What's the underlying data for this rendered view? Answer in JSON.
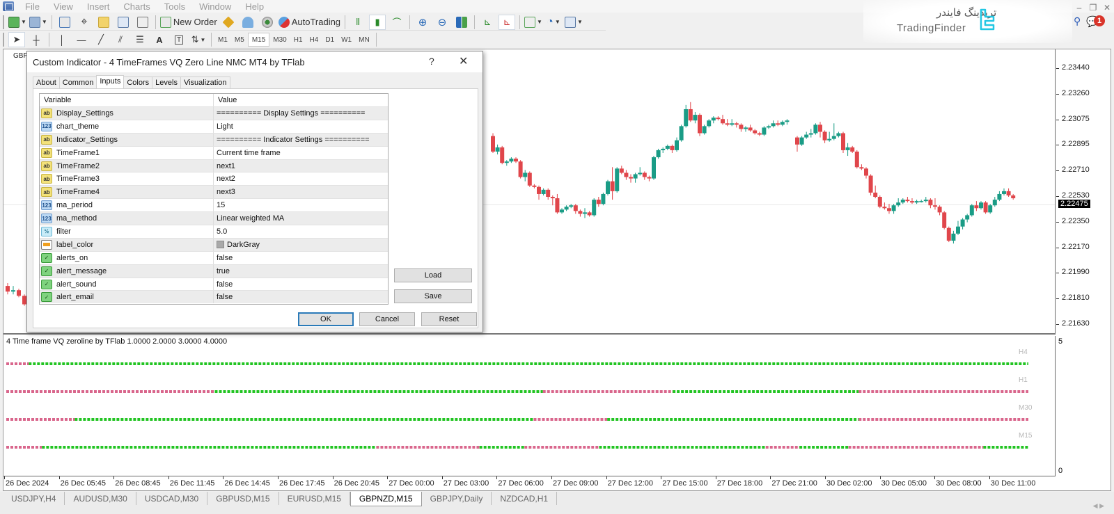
{
  "menu": [
    "File",
    "View",
    "Insert",
    "Charts",
    "Tools",
    "Window",
    "Help"
  ],
  "toolbar": {
    "new_order_label": "New Order",
    "autotrading_label": "AutoTrading",
    "timeframes": [
      "M1",
      "M5",
      "M15",
      "M30",
      "H1",
      "H4",
      "D1",
      "W1",
      "MN"
    ],
    "active_timeframe": "M15"
  },
  "branding": {
    "name_fa": "تریدینگ فایندر",
    "name_en": "TradingFinder",
    "accent": "#22c7e3"
  },
  "notifications": {
    "count": "1"
  },
  "chart": {
    "symbol_label": "GBP",
    "price_labels": [
      "2.23440",
      "2.23260",
      "2.23075",
      "2.22895",
      "2.22710",
      "2.22530",
      "2.22350",
      "2.22170",
      "2.21990",
      "2.21810",
      "2.21630"
    ],
    "current_price": "2.22475",
    "time_labels": [
      "26 Dec 2024",
      "26 Dec 05:45",
      "26 Dec 08:45",
      "26 Dec 11:45",
      "26 Dec 14:45",
      "26 Dec 17:45",
      "26 Dec 20:45",
      "27 Dec 00:00",
      "27 Dec 03:00",
      "27 Dec 06:00",
      "27 Dec 09:00",
      "27 Dec 12:00",
      "27 Dec 15:00",
      "27 Dec 18:00",
      "27 Dec 21:00",
      "30 Dec 02:00",
      "30 Dec 05:00",
      "30 Dec 08:00",
      "30 Dec 11:00"
    ],
    "bull_color": "#1a9c86",
    "bear_color": "#e0464b"
  },
  "indicator": {
    "title": "4 Time frame VQ zeroline by TFlab 1.0000 2.0000 3.0000 4.0000",
    "axis_max": "5",
    "axis_min": "0",
    "bull_color": "#22c422",
    "bear_color": "#d9668c"
  },
  "chart_data": {
    "type": "candlestick",
    "symbol": "GBPNZD",
    "timeframe": "M15",
    "ylim": [
      2.2155,
      2.2352
    ],
    "candles_visible_from_dialog_edge": [
      [
        2.2296,
        2.2298,
        2.2284,
        2.2285
      ],
      [
        2.2285,
        2.229,
        2.2283,
        2.2288
      ],
      [
        2.2288,
        2.2289,
        2.2276,
        2.2277
      ],
      [
        2.2277,
        2.2279,
        2.2275,
        2.2278
      ],
      [
        2.2278,
        2.2281,
        2.2277,
        2.228
      ],
      [
        2.228,
        2.2281,
        2.2277,
        2.2278
      ],
      [
        2.2278,
        2.2279,
        2.2266,
        2.2267
      ],
      [
        2.2267,
        2.2272,
        2.2264,
        2.227
      ],
      [
        2.227,
        2.2271,
        2.226,
        2.2261
      ],
      [
        2.2261,
        2.2262,
        2.2259,
        2.226
      ],
      [
        2.226,
        2.2261,
        2.2251,
        2.2255
      ],
      [
        2.2255,
        2.2259,
        2.2254,
        2.2258
      ],
      [
        2.2258,
        2.2259,
        2.2251,
        2.2253
      ],
      [
        2.2253,
        2.2254,
        2.2247,
        2.2252
      ],
      [
        2.2252,
        2.2255,
        2.2241,
        2.2242
      ],
      [
        2.2242,
        2.2245,
        2.2241,
        2.2244
      ],
      [
        2.2244,
        2.2247,
        2.2243,
        2.2246
      ],
      [
        2.2246,
        2.2248,
        2.2245,
        2.2247
      ],
      [
        2.2247,
        2.2248,
        2.2241,
        2.2243
      ],
      [
        2.2243,
        2.2244,
        2.2239,
        2.2241
      ],
      [
        2.2241,
        2.2245,
        2.2238,
        2.2242
      ],
      [
        2.2242,
        2.2243,
        2.2239,
        2.224
      ],
      [
        2.224,
        2.2252,
        2.2239,
        2.2251
      ],
      [
        2.2251,
        2.2253,
        2.2246,
        2.2248
      ],
      [
        2.2248,
        2.2256,
        2.2247,
        2.2255
      ],
      [
        2.2255,
        2.2265,
        2.2254,
        2.2264
      ],
      [
        2.2264,
        2.2274,
        2.2251,
        2.2257
      ],
      [
        2.2257,
        2.2274,
        2.2256,
        2.2273
      ],
      [
        2.2273,
        2.2275,
        2.2269,
        2.227
      ],
      [
        2.227,
        2.2272,
        2.2265,
        2.2267
      ],
      [
        2.2267,
        2.2269,
        2.2263,
        2.2266
      ],
      [
        2.2266,
        2.227,
        2.2263,
        2.2269
      ],
      [
        2.2269,
        2.2274,
        2.2268,
        2.227
      ],
      [
        2.227,
        2.2271,
        2.2265,
        2.2267
      ],
      [
        2.2267,
        2.2268,
        2.2264,
        2.2266
      ],
      [
        2.2266,
        2.2282,
        2.2265,
        2.2281
      ],
      [
        2.2281,
        2.2287,
        2.228,
        2.2286
      ],
      [
        2.2286,
        2.2288,
        2.2284,
        2.2287
      ],
      [
        2.2287,
        2.229,
        2.2286,
        2.2289
      ],
      [
        2.2289,
        2.229,
        2.2284,
        2.2286
      ],
      [
        2.2286,
        2.2295,
        2.2285,
        2.2293
      ],
      [
        2.2293,
        2.2304,
        2.2292,
        2.2303
      ],
      [
        2.2303,
        2.2318,
        2.2302,
        2.2315
      ],
      [
        2.2315,
        2.232,
        2.2306,
        2.2307
      ],
      [
        2.2307,
        2.2313,
        2.2305,
        2.2311
      ],
      [
        2.2311,
        2.2312,
        2.2296,
        2.2298
      ],
      [
        2.2298,
        2.2304,
        2.2297,
        2.2303
      ],
      [
        2.2303,
        2.2308,
        2.2302,
        2.2307
      ],
      [
        2.2307,
        2.231,
        2.2305,
        2.2309
      ],
      [
        2.2309,
        2.231,
        2.2307,
        2.2308
      ],
      [
        2.2308,
        2.2311,
        2.2304,
        2.2305
      ],
      [
        2.2305,
        2.2308,
        2.2303,
        2.2304
      ],
      [
        2.2304,
        2.2308,
        2.2303,
        2.2305
      ],
      [
        2.2305,
        2.2306,
        2.2302,
        2.2304
      ],
      [
        2.2304,
        2.2305,
        2.2299,
        2.2301
      ],
      [
        2.2301,
        2.2303,
        2.2299,
        2.2302
      ],
      [
        2.2302,
        2.2304,
        2.2299,
        2.23
      ],
      [
        2.23,
        2.2301,
        2.2297,
        2.2298
      ],
      [
        2.2298,
        2.2299,
        2.2296,
        2.2297
      ],
      [
        2.2297,
        2.2303,
        2.2296,
        2.2302
      ],
      [
        2.2302,
        2.2304,
        2.2301,
        2.2303
      ],
      [
        2.2303,
        2.2307,
        2.2302,
        2.2305
      ],
      [
        2.2305,
        2.2307,
        2.2303,
        2.2304
      ],
      [
        2.2304,
        2.2307,
        2.2303,
        2.2306
      ],
      [
        2.2306,
        2.2308,
        2.2304,
        2.2307
      ],
      [
        2.2295,
        2.2296,
        2.2285,
        2.229
      ],
      [
        2.229,
        2.2296,
        2.2289,
        2.2295
      ],
      [
        2.2295,
        2.2299,
        2.2294,
        2.2297
      ],
      [
        2.2297,
        2.2301,
        2.2295,
        2.2298
      ],
      [
        2.2298,
        2.2305,
        2.2297,
        2.2304
      ],
      [
        2.2304,
        2.2306,
        2.2295,
        2.2299
      ],
      [
        2.2299,
        2.23,
        2.2291,
        2.2293
      ],
      [
        2.2293,
        2.2299,
        2.2292,
        2.2294
      ],
      [
        2.2294,
        2.2305,
        2.2293,
        2.2296
      ],
      [
        2.2296,
        2.2299,
        2.2295,
        2.2298
      ],
      [
        2.2298,
        2.2299,
        2.2284,
        2.2286
      ],
      [
        2.2286,
        2.2291,
        2.2282,
        2.2288
      ],
      [
        2.2288,
        2.2289,
        2.2284,
        2.2285
      ],
      [
        2.2285,
        2.2286,
        2.2273,
        2.2274
      ],
      [
        2.2274,
        2.2276,
        2.2272,
        2.2273
      ],
      [
        2.2273,
        2.2274,
        2.2266,
        2.2268
      ],
      [
        2.2268,
        2.2269,
        2.2254,
        2.2256
      ],
      [
        2.2256,
        2.2261,
        2.2252,
        2.2253
      ],
      [
        2.2253,
        2.2254,
        2.2245,
        2.2246
      ],
      [
        2.2246,
        2.2249,
        2.2244,
        2.2245
      ],
      [
        2.2245,
        2.2248,
        2.2241,
        2.2243
      ],
      [
        2.2243,
        2.2248,
        2.2241,
        2.2247
      ],
      [
        2.2247,
        2.2252,
        2.2246,
        2.2249
      ],
      [
        2.2249,
        2.2252,
        2.2248,
        2.2251
      ],
      [
        2.2251,
        2.2253,
        2.2249,
        2.225
      ],
      [
        2.225,
        2.2252,
        2.2248,
        2.2249
      ],
      [
        2.2249,
        2.2251,
        2.2248,
        2.225
      ],
      [
        2.225,
        2.2251,
        2.2249,
        2.225
      ],
      [
        2.225,
        2.2253,
        2.2249,
        2.2251
      ],
      [
        2.2251,
        2.2252,
        2.2245,
        2.2247
      ],
      [
        2.2247,
        2.2252,
        2.2244,
        2.2246
      ],
      [
        2.2246,
        2.2247,
        2.224,
        2.2242
      ],
      [
        2.2242,
        2.2243,
        2.223,
        2.2231
      ],
      [
        2.2231,
        2.2232,
        2.2221,
        2.2222
      ],
      [
        2.2222,
        2.2229,
        2.222,
        2.2227
      ],
      [
        2.2227,
        2.2236,
        2.2226,
        2.2232
      ],
      [
        2.2232,
        2.2238,
        2.223,
        2.2237
      ],
      [
        2.2237,
        2.2241,
        2.2235,
        2.224
      ],
      [
        2.224,
        2.2248,
        2.2239,
        2.2247
      ],
      [
        2.2247,
        2.225,
        2.2243,
        2.2245
      ],
      [
        2.2245,
        2.225,
        2.2244,
        2.2249
      ],
      [
        2.2249,
        2.225,
        2.2241,
        2.2242
      ],
      [
        2.2242,
        2.2248,
        2.2241,
        2.2247
      ],
      [
        2.2247,
        2.2253,
        2.2246,
        2.2251
      ],
      [
        2.2251,
        2.2257,
        2.225,
        2.2255
      ],
      [
        2.2255,
        2.2259,
        2.2254,
        2.2257
      ],
      [
        2.2257,
        2.2259,
        2.2253,
        2.2254
      ],
      [
        2.2254,
        2.2255,
        2.2251,
        2.2252
      ]
    ],
    "indicator_rows": [
      {
        "label": "H4",
        "segments": [
          [
            "bear",
            0.0,
            0.022
          ],
          [
            "bull",
            0.022,
            1.0
          ]
        ]
      },
      {
        "label": "H1",
        "segments": [
          [
            "bear",
            0.0,
            0.204
          ],
          [
            "bull",
            0.204,
            0.525
          ],
          [
            "bear",
            0.525,
            0.652
          ],
          [
            "bull",
            0.652,
            0.834
          ],
          [
            "bear",
            0.834,
            1.0
          ]
        ]
      },
      {
        "label": "M30",
        "segments": [
          [
            "bear",
            0.0,
            0.067
          ],
          [
            "bull",
            0.067,
            0.516
          ],
          [
            "bear",
            0.516,
            0.588
          ],
          [
            "bull",
            0.588,
            0.834
          ],
          [
            "bear",
            0.834,
            1.0
          ]
        ]
      },
      {
        "label": "M15",
        "segments": [
          [
            "bear",
            0.0,
            0.035
          ],
          [
            "bull",
            0.035,
            0.362
          ],
          [
            "bear",
            0.362,
            0.463
          ],
          [
            "bull",
            0.463,
            0.507
          ],
          [
            "bear",
            0.507,
            0.58
          ],
          [
            "bull",
            0.58,
            0.743
          ],
          [
            "bear",
            0.743,
            0.776
          ],
          [
            "bull",
            0.776,
            0.824
          ],
          [
            "bear",
            0.824,
            0.956
          ],
          [
            "bull",
            0.956,
            1.0
          ]
        ]
      }
    ]
  },
  "dialog": {
    "title": "Custom Indicator - 4 TimeFrames VQ Zero Line NMC MT4 by TFlab",
    "help": "?",
    "close": "✕",
    "tabs": [
      "About",
      "Common",
      "Inputs",
      "Colors",
      "Levels",
      "Visualization"
    ],
    "active_tab": "Inputs",
    "columns": [
      "Variable",
      "Value"
    ],
    "inputs": [
      {
        "type": "string",
        "icon": "ab",
        "name": "Display_Settings",
        "value": "========== Display Settings =========="
      },
      {
        "type": "int",
        "icon": "123",
        "name": "chart_theme",
        "value": "Light"
      },
      {
        "type": "string",
        "icon": "ab",
        "name": "Indicator_Settings",
        "value": "========== Indicator Settings =========="
      },
      {
        "type": "string",
        "icon": "ab",
        "name": "TimeFrame1",
        "value": "Current time frame"
      },
      {
        "type": "string",
        "icon": "ab",
        "name": "TimeFrame2",
        "value": "next1"
      },
      {
        "type": "string",
        "icon": "ab",
        "name": "TimeFrame3",
        "value": "next2"
      },
      {
        "type": "string",
        "icon": "ab",
        "name": "TimeFrame4",
        "value": "next3"
      },
      {
        "type": "int",
        "icon": "123",
        "name": "ma_period",
        "value": "15"
      },
      {
        "type": "int",
        "icon": "123",
        "name": "ma_method",
        "value": "Linear weighted MA"
      },
      {
        "type": "double",
        "icon": "½",
        "name": "filter",
        "value": "5.0"
      },
      {
        "type": "color",
        "icon": "",
        "name": "label_color",
        "value": "DarkGray",
        "swatch": "#a9a9a9"
      },
      {
        "type": "bool",
        "icon": "✓",
        "name": "alerts_on",
        "value": "false"
      },
      {
        "type": "bool",
        "icon": "✓",
        "name": "alert_message",
        "value": "true"
      },
      {
        "type": "bool",
        "icon": "✓",
        "name": "alert_sound",
        "value": "false"
      },
      {
        "type": "bool",
        "icon": "✓",
        "name": "alert_email",
        "value": "false"
      }
    ],
    "buttons": {
      "load": "Load",
      "save": "Save",
      "ok": "OK",
      "cancel": "Cancel",
      "reset": "Reset"
    }
  },
  "bottom_tabs": [
    "USDJPY,H4",
    "AUDUSD,M30",
    "USDCAD,M30",
    "GBPUSD,M15",
    "EURUSD,M15",
    "GBPNZD,M15",
    "GBPJPY,Daily",
    "NZDCAD,H1"
  ],
  "active_bottom_tab": "GBPNZD,M15"
}
